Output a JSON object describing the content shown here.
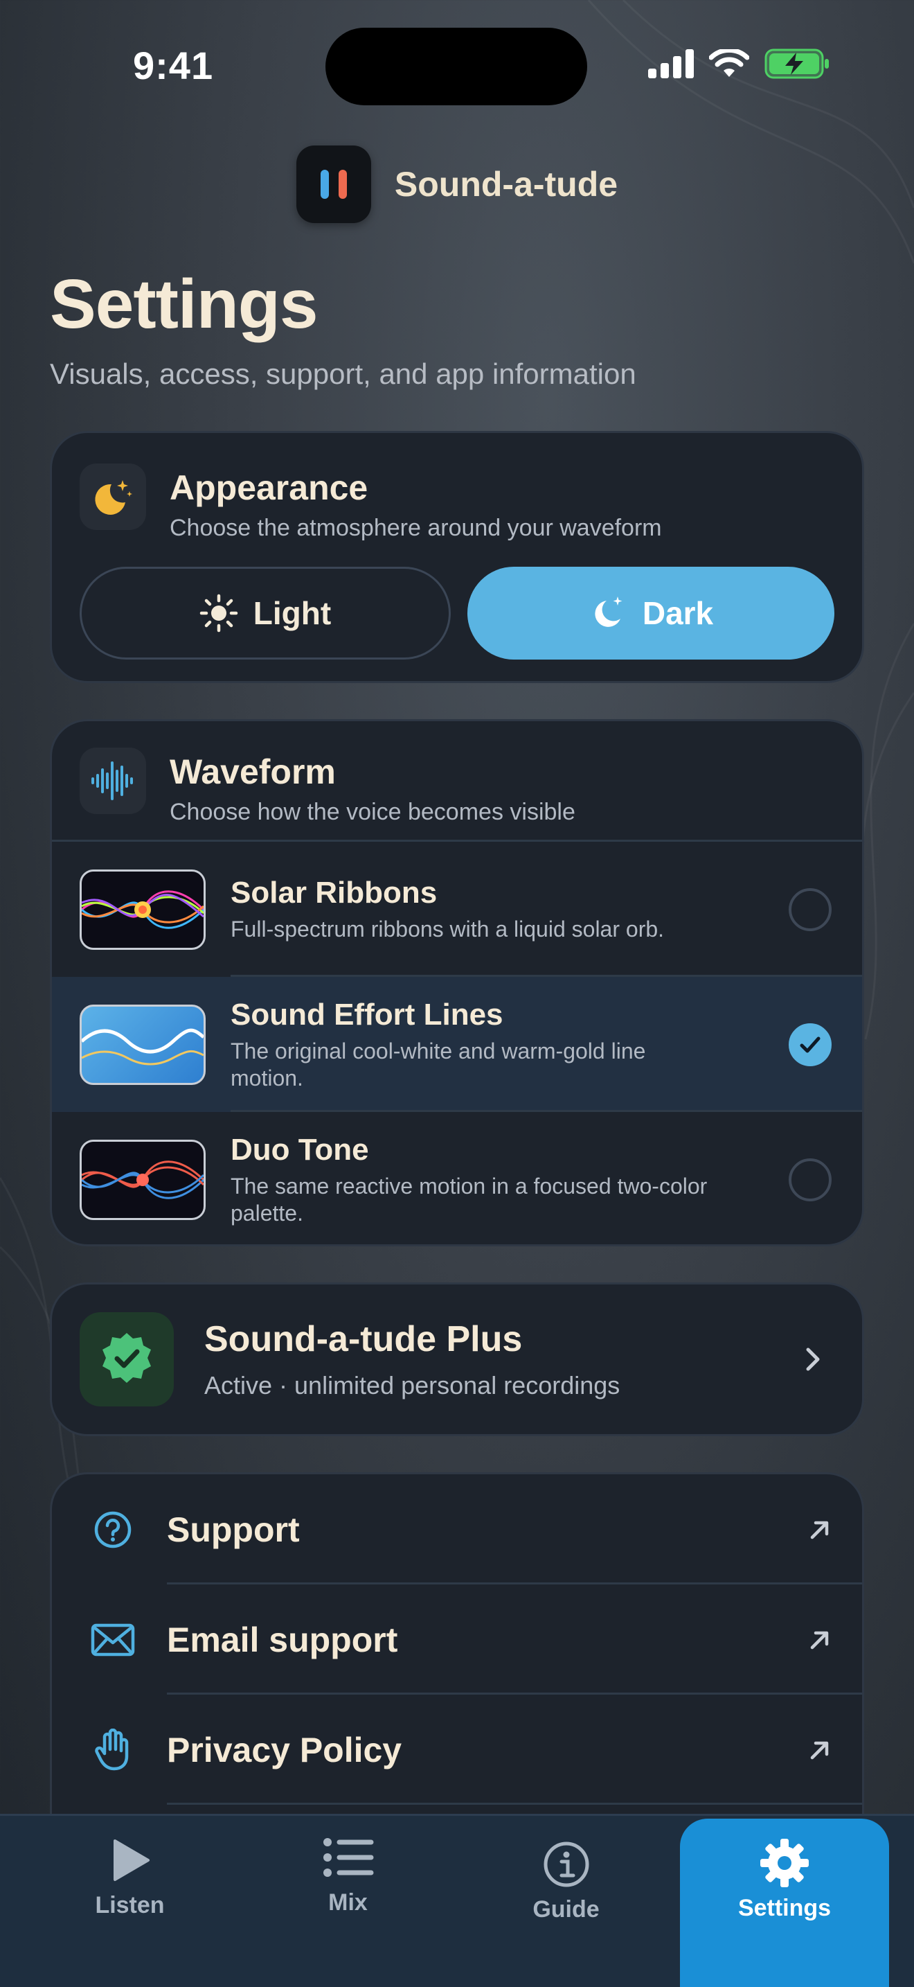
{
  "status": {
    "time": "9:41"
  },
  "app": {
    "name": "Sound-a-tude"
  },
  "page": {
    "title": "Settings",
    "subtitle": "Visuals, access, support, and app information"
  },
  "appearance": {
    "icon": "moon-stars-icon",
    "title": "Appearance",
    "description": "Choose the atmosphere around your waveform",
    "options": [
      {
        "label": "Light",
        "icon": "sun-icon",
        "selected": false
      },
      {
        "label": "Dark",
        "icon": "moon-icon",
        "selected": true
      }
    ]
  },
  "waveform": {
    "icon": "waveform-icon",
    "title": "Waveform",
    "description": "Choose how the voice becomes visible",
    "options": [
      {
        "title": "Solar Ribbons",
        "description": "Full-spectrum ribbons with a liquid solar orb.",
        "selected": false
      },
      {
        "title": "Sound Effort Lines",
        "description": "The original cool-white and warm-gold line motion.",
        "selected": true
      },
      {
        "title": "Duo Tone",
        "description": "The same reactive motion in a focused two-color palette.",
        "selected": false
      }
    ]
  },
  "plus": {
    "icon": "verified-badge-icon",
    "title": "Sound-a-tude Plus",
    "description": "Active · unlimited personal recordings"
  },
  "links": [
    {
      "label": "Support",
      "icon": "question-circle-icon"
    },
    {
      "label": "Email support",
      "icon": "envelope-icon"
    },
    {
      "label": "Privacy Policy",
      "icon": "hand-icon"
    }
  ],
  "tabs": [
    {
      "label": "Listen",
      "icon": "play-icon",
      "active": false
    },
    {
      "label": "Mix",
      "icon": "list-icon",
      "active": false
    },
    {
      "label": "Guide",
      "icon": "info-icon",
      "active": false
    },
    {
      "label": "Settings",
      "icon": "gear-icon",
      "active": true
    }
  ],
  "colors": {
    "accent": "#5ab4e2",
    "active_tab": "#1a8fd6",
    "card": "#1d232c",
    "title_text": "#f5ead6",
    "plus_green": "#4cc27a",
    "battery_green": "#4ed164"
  }
}
